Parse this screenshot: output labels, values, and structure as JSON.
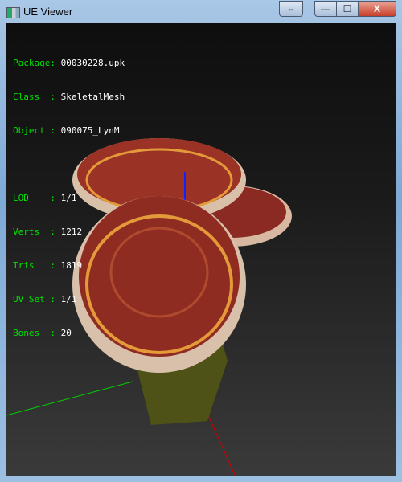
{
  "window": {
    "title": "UE Viewer",
    "buttons": {
      "resize": "⇔",
      "minimize": "—",
      "maximize": "☐",
      "close": "X"
    }
  },
  "info": {
    "package": {
      "label": "Package: ",
      "value": "00030228.upk"
    },
    "class": {
      "label": "Class  : ",
      "value": "SkeletalMesh"
    },
    "object": {
      "label": "Object : ",
      "value": "090075_LynM"
    },
    "lod": {
      "label": "LOD    : ",
      "value": "1/1"
    },
    "verts": {
      "label": "Verts  : ",
      "value": "1212"
    },
    "tris": {
      "label": "Tris   : ",
      "value": "1819"
    },
    "uvset": {
      "label": "UV Set : ",
      "value": "1/1"
    },
    "bones": {
      "label": "Bones  : ",
      "value": "20"
    }
  },
  "colors": {
    "label": "#00e000",
    "value": "#ffffff",
    "cap": "#8a2a22",
    "rim": "#e59a3a",
    "stem": "#5a5a18"
  }
}
